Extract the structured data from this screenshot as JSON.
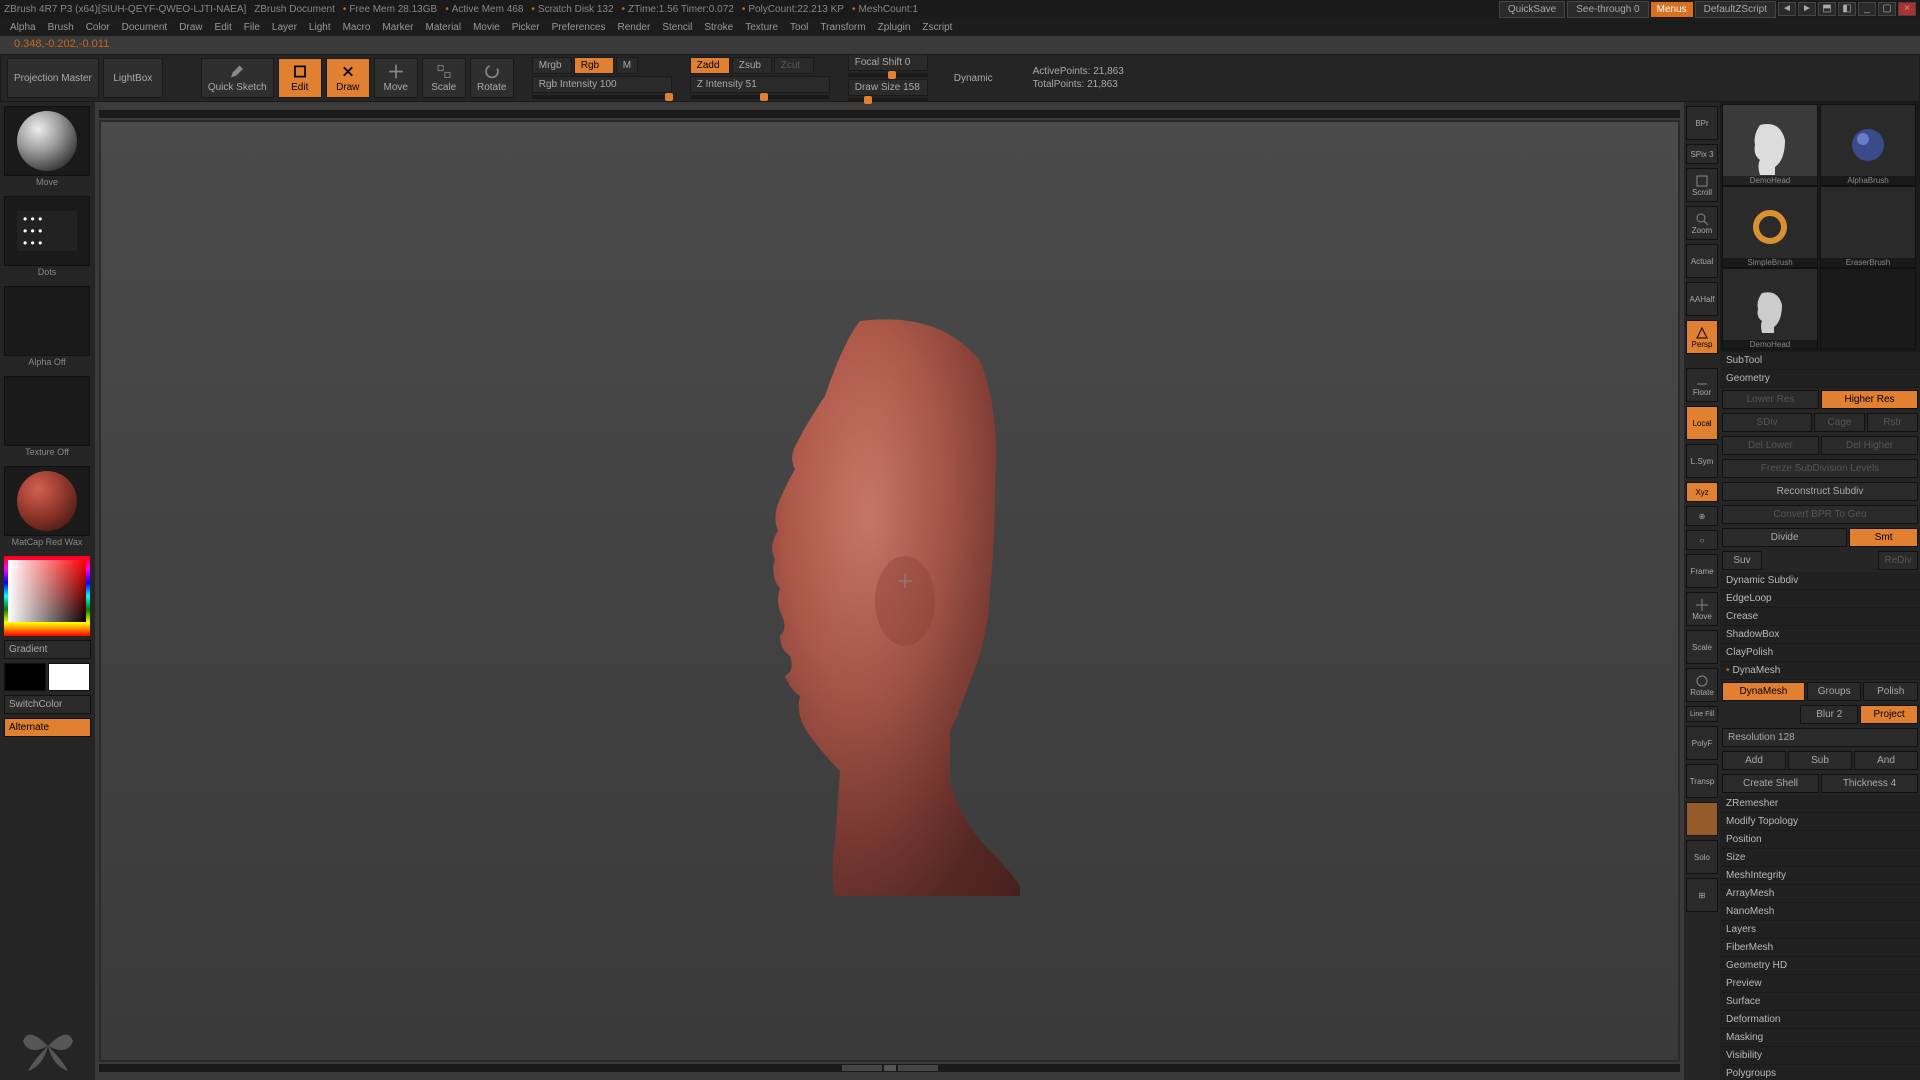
{
  "titlebar": {
    "project": "ZBrush 4R7 P3 (x64)[SIUH-QEYF-QWEO-LJTI-NAEA]",
    "doc": "ZBrush Document",
    "freemem": "Free Mem 28.13GB",
    "activemem": "Active Mem 468",
    "scratch": "Scratch Disk 132",
    "ztime": "ZTime:1.56 Timer:0.072",
    "polycount": "PolyCount:22.213 KP",
    "meshcount": "MeshCount:1",
    "quicksave": "QuickSave",
    "seethrough": "See-through  0",
    "menus": "Menus",
    "script": "DefaultZScript"
  },
  "menubar": [
    "Alpha",
    "Brush",
    "Color",
    "Document",
    "Draw",
    "Edit",
    "File",
    "Layer",
    "Light",
    "Macro",
    "Marker",
    "Material",
    "Movie",
    "Picker",
    "Preferences",
    "Render",
    "Stencil",
    "Stroke",
    "Texture",
    "Tool",
    "Transform",
    "Zplugin",
    "Zscript"
  ],
  "status": "0.348,-0.202,-0.011",
  "toptool": {
    "projection": "Projection Master",
    "lightbox": "LightBox",
    "quicksketch": "Quick Sketch",
    "edit": "Edit",
    "draw": "Draw",
    "move": "Move",
    "scale": "Scale",
    "rotate": "Rotate",
    "mrgb": "Mrgb",
    "rgb": "Rgb",
    "m": "M",
    "rgb_intensity": "Rgb Intensity 100",
    "zadd": "Zadd",
    "zsub": "Zsub",
    "zcut": "Zcut",
    "z_intensity": "Z Intensity 51",
    "focal": "Focal Shift 0",
    "drawsize": "Draw Size 158",
    "dynamic": "Dynamic",
    "active": "ActivePoints: 21,863",
    "total": "TotalPoints: 21,863"
  },
  "left": {
    "move": "Move",
    "dots": "Dots",
    "alpha": "Alpha Off",
    "texture": "Texture Off",
    "matcap": "MatCap Red Wax",
    "gradient": "Gradient",
    "switchcolor": "SwitchColor",
    "alternate": "Alternate"
  },
  "iconstrip": {
    "bpr": "BPr",
    "spix": "SPix 3",
    "scroll": "Scroll",
    "zoom": "Zoom",
    "actual": "Actual",
    "aahalf": "AAHalf",
    "persp": "Persp",
    "floor": "Floor",
    "local": "Local",
    "lsym": "L.Sym",
    "xyz": "Xyz",
    "frame": "Frame",
    "move": "Move",
    "scale": "Scale",
    "rot": "Rotate",
    "linefill": "Line Fill",
    "polyf": "PolyF",
    "transp": "Transp",
    "solo": "Solo"
  },
  "rightthumbs": {
    "demohead": "DemoHead",
    "alphabrush": "AlphaBrush",
    "simplebrush": "SimpleBrush",
    "eraserbrush": "EraserBrush",
    "demohead2": "DemoHead"
  },
  "props": {
    "subtool": "SubTool",
    "geometry": "Geometry",
    "lower": "Lower Res",
    "higher": "Higher Res",
    "sdiv": "SDiv",
    "cage": "Cage",
    "rstr": "Rstr",
    "dellower": "Del Lower",
    "delhigher": "Del Higher",
    "freeze": "Freeze SubDivision Levels",
    "reconstruct": "Reconstruct Subdiv",
    "convert": "Convert BPR To Geo",
    "divide": "Divide",
    "smt": "Smt",
    "suv": "Suv",
    "rdiv": "ReDiv",
    "dynamicsubdiv": "Dynamic Subdiv",
    "edgeloop": "EdgeLoop",
    "crease": "Crease",
    "shadowbox": "ShadowBox",
    "claypolish": "ClayPolish",
    "dynamesh": "DynaMesh",
    "dynameshbtn": "DynaMesh",
    "groups": "Groups",
    "polish": "Polish",
    "blur": "Blur 2",
    "project": "Project",
    "resolution": "Resolution 128",
    "add": "Add",
    "sub": "Sub",
    "and": "And",
    "createshell": "Create Shell",
    "thickness": "Thickness 4",
    "zremesher": "ZRemesher",
    "modtopo": "Modify Topology",
    "position": "Position",
    "size": "Size",
    "meshintegrity": "MeshIntegrity",
    "arraymesh": "ArrayMesh",
    "nanomesh": "NanoMesh",
    "layers": "Layers",
    "fibermesh": "FiberMesh",
    "geohd": "Geometry HD",
    "preview": "Preview",
    "surface": "Surface",
    "deformation": "Deformation",
    "masking": "Masking",
    "visibility": "Visibility",
    "polygroups": "Polygroups"
  }
}
